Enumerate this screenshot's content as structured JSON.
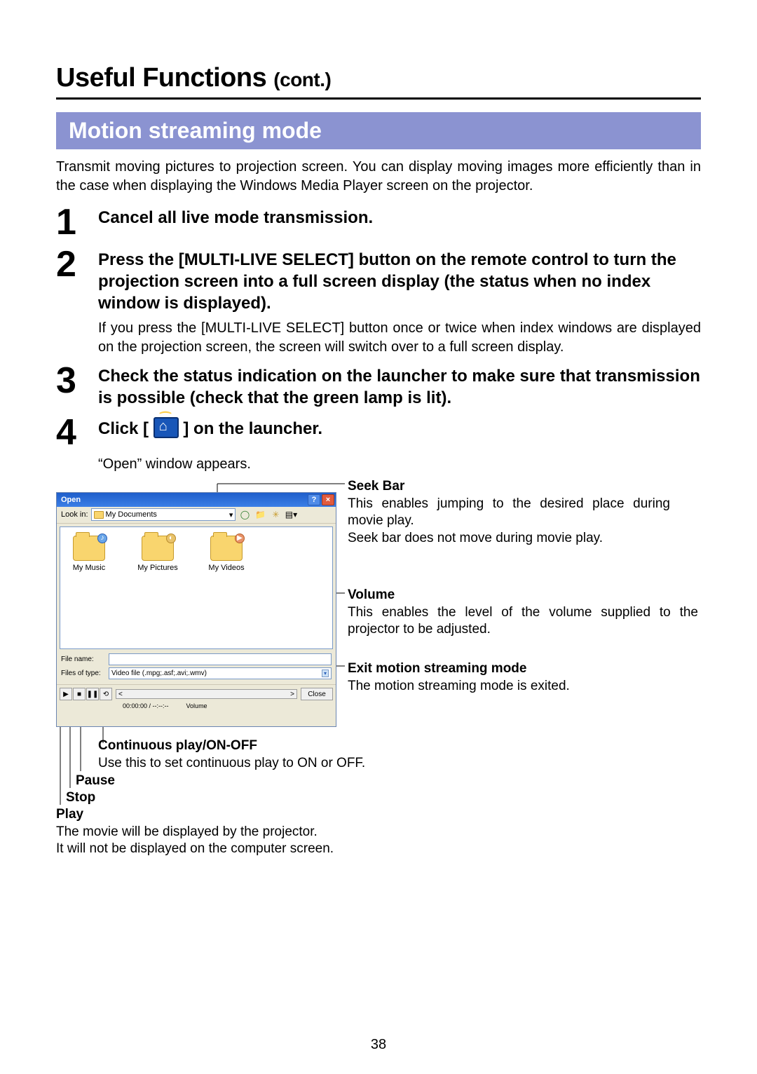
{
  "page": {
    "title_main": "Useful Functions ",
    "title_cont": "(cont.)",
    "number": "38"
  },
  "section": {
    "bar": "Motion streaming mode",
    "intro": "Transmit moving pictures to projection screen. You can display moving images more efficiently than in the case when displaying the Windows Media Player screen on the projector."
  },
  "steps": [
    {
      "num": "1",
      "title": "Cancel all live mode transmission."
    },
    {
      "num": "2",
      "title": "Press the [MULTI-LIVE SELECT] button on the remote control to turn the projection screen into a full screen display (the status when no index window is displayed).",
      "text": "If you press the [MULTI-LIVE SELECT] button once or twice when index windows are displayed on the projection screen, the screen will switch over to a full screen display."
    },
    {
      "num": "3",
      "title": "Check the status indication on the launcher to make sure that transmission is possible (check that the green lamp is lit)."
    },
    {
      "num": "4",
      "title_pre": "Click [",
      "title_post": "] on the launcher.",
      "after": "“Open” window appears."
    }
  ],
  "open_window": {
    "title": "Open",
    "look_in_label": "Look in:",
    "look_in_value": "My Documents",
    "folders": [
      "My Music",
      "My Pictures",
      "My Videos"
    ],
    "file_name_label": "File name:",
    "files_of_type_label": "Files of type:",
    "files_of_type_value": "Video file (.mpg;.asf;.avi;.wmv)",
    "close": "Close",
    "time": "00:00:00  /  --:--:--",
    "volume_label": "Volume"
  },
  "annotations": {
    "seek": {
      "title": "Seek Bar",
      "text1": "This enables jumping to the desired place during movie play.",
      "text2": "Seek bar does not move during movie play."
    },
    "volume": {
      "title": "Volume",
      "text": "This enables the level of the volume supplied to the projector to be adjusted."
    },
    "exit": {
      "title": "Exit motion streaming mode",
      "text": "The motion streaming mode is exited."
    },
    "cont": {
      "title": "Continuous play/ON-OFF",
      "text": "Use this to set continuous play to ON or OFF."
    },
    "pause": "Pause",
    "stop": "Stop",
    "play": {
      "title": "Play",
      "text1": "The movie will be displayed by the projector.",
      "text2": "It will not be displayed on the computer screen."
    }
  }
}
